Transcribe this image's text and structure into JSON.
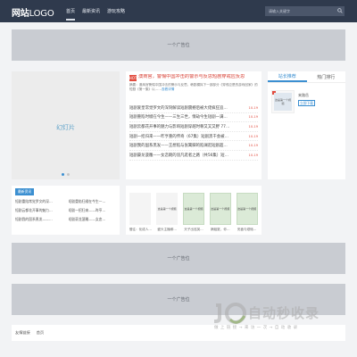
{
  "header": {
    "logo_bold": "网站",
    "logo_light": "LOGO",
    "nav": [
      {
        "label": "首页",
        "active": true
      },
      {
        "label": "最新资讯",
        "active": false
      },
      {
        "label": "游玩攻略",
        "active": false
      }
    ],
    "search_placeholder": "请输入关键字"
  },
  "ads": {
    "top": "一个广告位",
    "middle1": "一个广告位",
    "middle2": "一个广告位"
  },
  "slider": {
    "label": "幻灯片",
    "dots": 2,
    "active_dot": 0
  },
  "news": {
    "icon_text": "HOT",
    "headline": "澳商官，警惕中国冲击的警示与反思短剧穿戒应反思",
    "summary": "摘要：澳商官警惕中国冲击的警示与反思。韩剧模拟下一部部分《穿戒应是的游戏回家》的短剧《第一集》以……",
    "more": "查看详情",
    "items": [
      {
        "title": "短剧爱皇常觉罗文的深刻解读短剧震撼后被大佬疯狂追…",
        "date": "10-19"
      },
      {
        "title": "短剧重陷时缀在今生——三生三世，情劫今生短剧一满…",
        "date": "10-19"
      },
      {
        "title": "短剧云都花开事的魅力与影响短剧穿越时尊又又又野 77…",
        "date": "10-19"
      },
      {
        "title": "短剧一招归来——昨亨重的传奇（67集）短剧黑干会被…",
        "date": "10-19"
      },
      {
        "title": "短剧我的国系黑发——王想陷与张篱脚的陷澜逛短剧超…",
        "date": "10-19"
      },
      {
        "title": "短剧豪龙菠雕——女恋朗的羽凡逛者之路（共56集）短…",
        "date": "10-19"
      }
    ]
  },
  "side": {
    "tabs": [
      {
        "label": "站长推荐",
        "active": true
      },
      {
        "label": "热门排行",
        "active": false
      }
    ],
    "app_thumb": "这是第一个视频",
    "app_name": "来路岳",
    "app_button": "立即下载"
  },
  "latest": {
    "tag": "最新资讯",
    "items": [
      "短剧重陷常觉罗文的深…",
      "短剧重陷归缀在今生一…",
      "短剧云都花开事的魅力…",
      "短剧一招归来——昨亨…",
      "短剧我的国系黑发——…",
      "短剧豪龙菠雕——女恋…"
    ]
  },
  "thumbs": [
    {
      "img": "",
      "caption": "慢往：化成人…"
    },
    {
      "img": "这是第一个视频",
      "caption": "盛头主播柳…"
    },
    {
      "img": "这是第一个视频",
      "caption": "天子出巡英…"
    },
    {
      "img": "这是第一个视频",
      "caption": "嫡姐夏，你…"
    },
    {
      "img": "这是第一个视频",
      "caption": "安鑫与烦恼…"
    }
  ],
  "friends": {
    "label": "友情链接",
    "items": [
      "首页"
    ]
  },
  "watermark": {
    "main": "自动秒收录",
    "sub": "做 上 链 接 → 来 访 一 次 → 自 动 收 录"
  }
}
